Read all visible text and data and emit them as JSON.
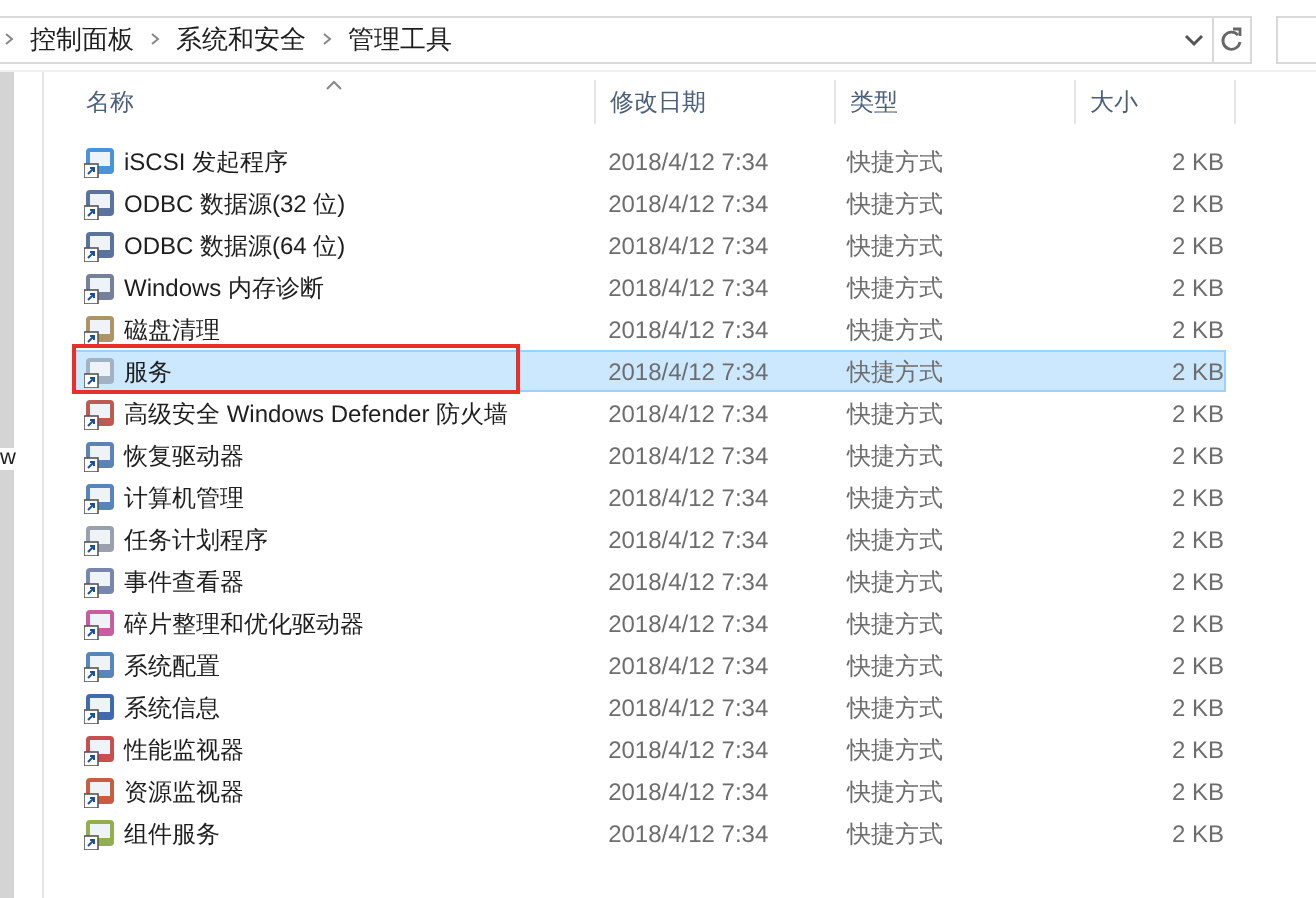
{
  "address_bar": {
    "breadcrumbs": [
      "控制面板",
      "系统和安全",
      "管理工具"
    ]
  },
  "nav_pane": {
    "text": "w"
  },
  "table": {
    "columns": [
      {
        "label": "名称",
        "sorted": true
      },
      {
        "label": "修改日期",
        "sorted": false
      },
      {
        "label": "类型",
        "sorted": false
      },
      {
        "label": "大小",
        "sorted": false
      }
    ],
    "rows": [
      {
        "name": "iSCSI 发起程序",
        "date": "2018/4/12 7:34",
        "type": "快捷方式",
        "size": "2 KB",
        "selected": false,
        "outlined": false
      },
      {
        "name": "ODBC 数据源(32 位)",
        "date": "2018/4/12 7:34",
        "type": "快捷方式",
        "size": "2 KB",
        "selected": false,
        "outlined": false
      },
      {
        "name": "ODBC 数据源(64 位)",
        "date": "2018/4/12 7:34",
        "type": "快捷方式",
        "size": "2 KB",
        "selected": false,
        "outlined": false
      },
      {
        "name": "Windows 内存诊断",
        "date": "2018/4/12 7:34",
        "type": "快捷方式",
        "size": "2 KB",
        "selected": false,
        "outlined": false
      },
      {
        "name": "磁盘清理",
        "date": "2018/4/12 7:34",
        "type": "快捷方式",
        "size": "2 KB",
        "selected": false,
        "outlined": false
      },
      {
        "name": "服务",
        "date": "2018/4/12 7:34",
        "type": "快捷方式",
        "size": "2 KB",
        "selected": true,
        "outlined": true
      },
      {
        "name": "高级安全 Windows Defender 防火墙",
        "date": "2018/4/12 7:34",
        "type": "快捷方式",
        "size": "2 KB",
        "selected": false,
        "outlined": false
      },
      {
        "name": "恢复驱动器",
        "date": "2018/4/12 7:34",
        "type": "快捷方式",
        "size": "2 KB",
        "selected": false,
        "outlined": false
      },
      {
        "name": "计算机管理",
        "date": "2018/4/12 7:34",
        "type": "快捷方式",
        "size": "2 KB",
        "selected": false,
        "outlined": false
      },
      {
        "name": "任务计划程序",
        "date": "2018/4/12 7:34",
        "type": "快捷方式",
        "size": "2 KB",
        "selected": false,
        "outlined": false
      },
      {
        "name": "事件查看器",
        "date": "2018/4/12 7:34",
        "type": "快捷方式",
        "size": "2 KB",
        "selected": false,
        "outlined": false
      },
      {
        "name": "碎片整理和优化驱动器",
        "date": "2018/4/12 7:34",
        "type": "快捷方式",
        "size": "2 KB",
        "selected": false,
        "outlined": false
      },
      {
        "name": "系统配置",
        "date": "2018/4/12 7:34",
        "type": "快捷方式",
        "size": "2 KB",
        "selected": false,
        "outlined": false
      },
      {
        "name": "系统信息",
        "date": "2018/4/12 7:34",
        "type": "快捷方式",
        "size": "2 KB",
        "selected": false,
        "outlined": false
      },
      {
        "name": "性能监视器",
        "date": "2018/4/12 7:34",
        "type": "快捷方式",
        "size": "2 KB",
        "selected": false,
        "outlined": false
      },
      {
        "name": "资源监视器",
        "date": "2018/4/12 7:34",
        "type": "快捷方式",
        "size": "2 KB",
        "selected": false,
        "outlined": false
      },
      {
        "name": "组件服务",
        "date": "2018/4/12 7:34",
        "type": "快捷方式",
        "size": "2 KB",
        "selected": false,
        "outlined": false
      }
    ]
  }
}
